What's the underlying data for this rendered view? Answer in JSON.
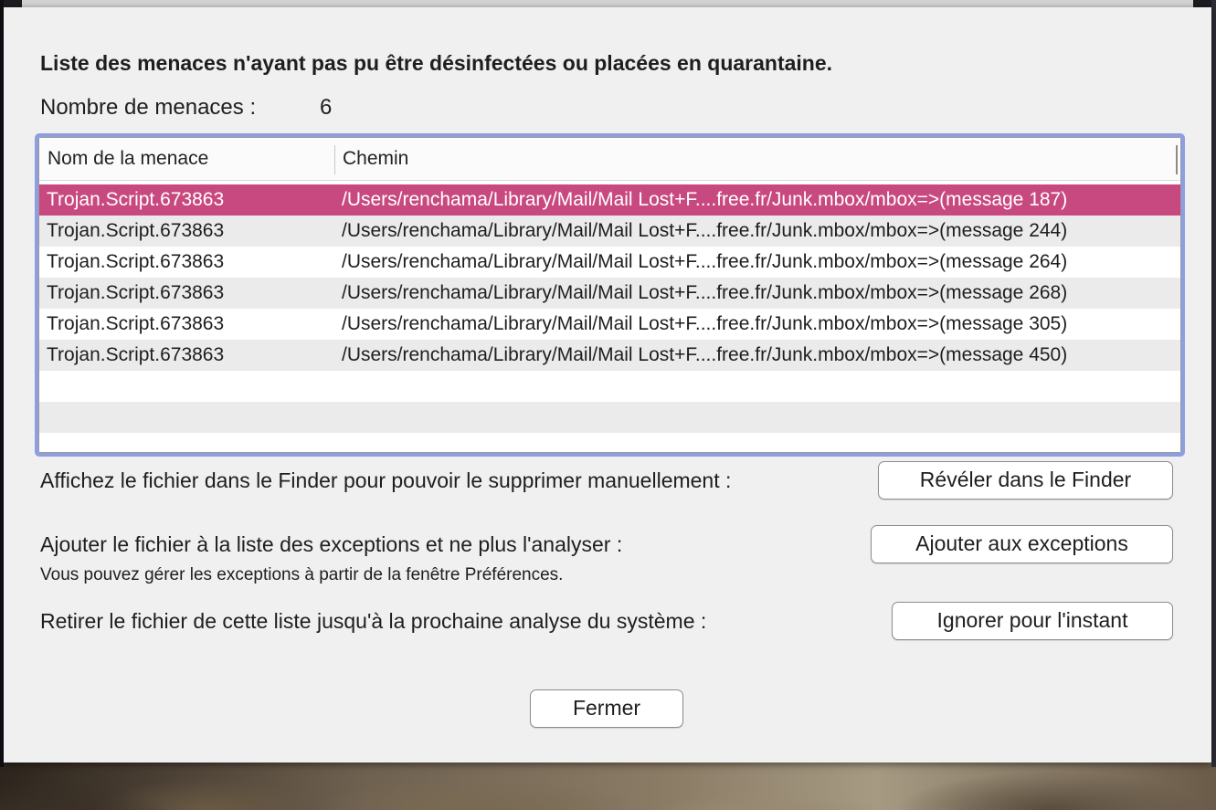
{
  "dialog": {
    "title": "Liste des menaces n'ayant pas pu être désinfectées ou placées en quarantaine.",
    "count_label": "Nombre de menaces :",
    "count_value": "6"
  },
  "table": {
    "columns": [
      "Nom de la menace",
      "Chemin"
    ],
    "rows": [
      {
        "name": "Trojan.Script.673863",
        "path": "/Users/renchama/Library/Mail/Mail Lost+F....free.fr/Junk.mbox/mbox=>(message 187)",
        "selected": true
      },
      {
        "name": "Trojan.Script.673863",
        "path": "/Users/renchama/Library/Mail/Mail Lost+F....free.fr/Junk.mbox/mbox=>(message 244)",
        "selected": false
      },
      {
        "name": "Trojan.Script.673863",
        "path": "/Users/renchama/Library/Mail/Mail Lost+F....free.fr/Junk.mbox/mbox=>(message 264)",
        "selected": false
      },
      {
        "name": "Trojan.Script.673863",
        "path": "/Users/renchama/Library/Mail/Mail Lost+F....free.fr/Junk.mbox/mbox=>(message 268)",
        "selected": false
      },
      {
        "name": "Trojan.Script.673863",
        "path": "/Users/renchama/Library/Mail/Mail Lost+F....free.fr/Junk.mbox/mbox=>(message 305)",
        "selected": false
      },
      {
        "name": "Trojan.Script.673863",
        "path": "/Users/renchama/Library/Mail/Mail Lost+F....free.fr/Junk.mbox/mbox=>(message 450)",
        "selected": false
      }
    ]
  },
  "actions": {
    "reveal_text": "Affichez le fichier dans le Finder pour pouvoir le supprimer manuellement :",
    "reveal_button": "Révéler dans le Finder",
    "exception_text": "Ajouter le fichier à la liste des exceptions et ne plus l'analyser :",
    "exception_subtext": "Vous pouvez gérer les exceptions à partir de la fenêtre Préférences.",
    "exception_button": "Ajouter aux exceptions",
    "ignore_text": "Retirer le fichier de cette liste jusqu'à la prochaine analyse du système :",
    "ignore_button": "Ignorer pour l'instant"
  },
  "footer": {
    "close_button": "Fermer"
  },
  "colors": {
    "selection": "#c8497f",
    "focus_ring": "#8e9ee0",
    "sheet_background": "#f0f0f0"
  }
}
